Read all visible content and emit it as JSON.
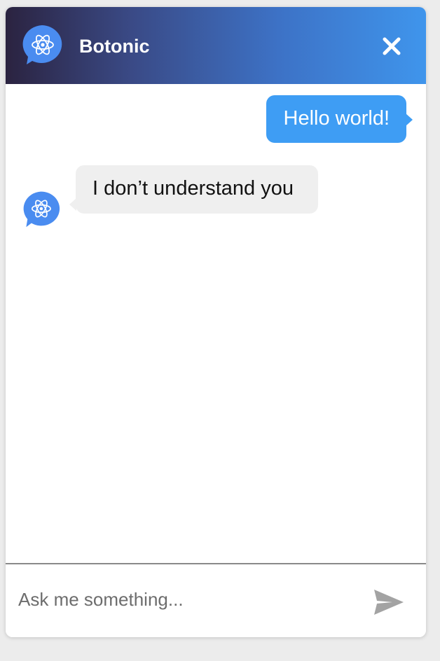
{
  "header": {
    "title": "Botonic",
    "logo_icon": "atom-chat-bubble-icon",
    "close_icon": "close-icon"
  },
  "messages": [
    {
      "from": "user",
      "text": "Hello world!"
    },
    {
      "from": "bot",
      "text": "I don’t understand you",
      "avatar_icon": "atom-chat-bubble-icon"
    }
  ],
  "input": {
    "placeholder": "Ask me something...",
    "value": "",
    "send_icon": "send-icon"
  },
  "colors": {
    "header_gradient_start": "#2b2340",
    "header_gradient_end": "#3f95ec",
    "user_bubble": "#3e9df4",
    "bot_bubble": "#efefef",
    "logo_blue": "#4a8cf0"
  }
}
